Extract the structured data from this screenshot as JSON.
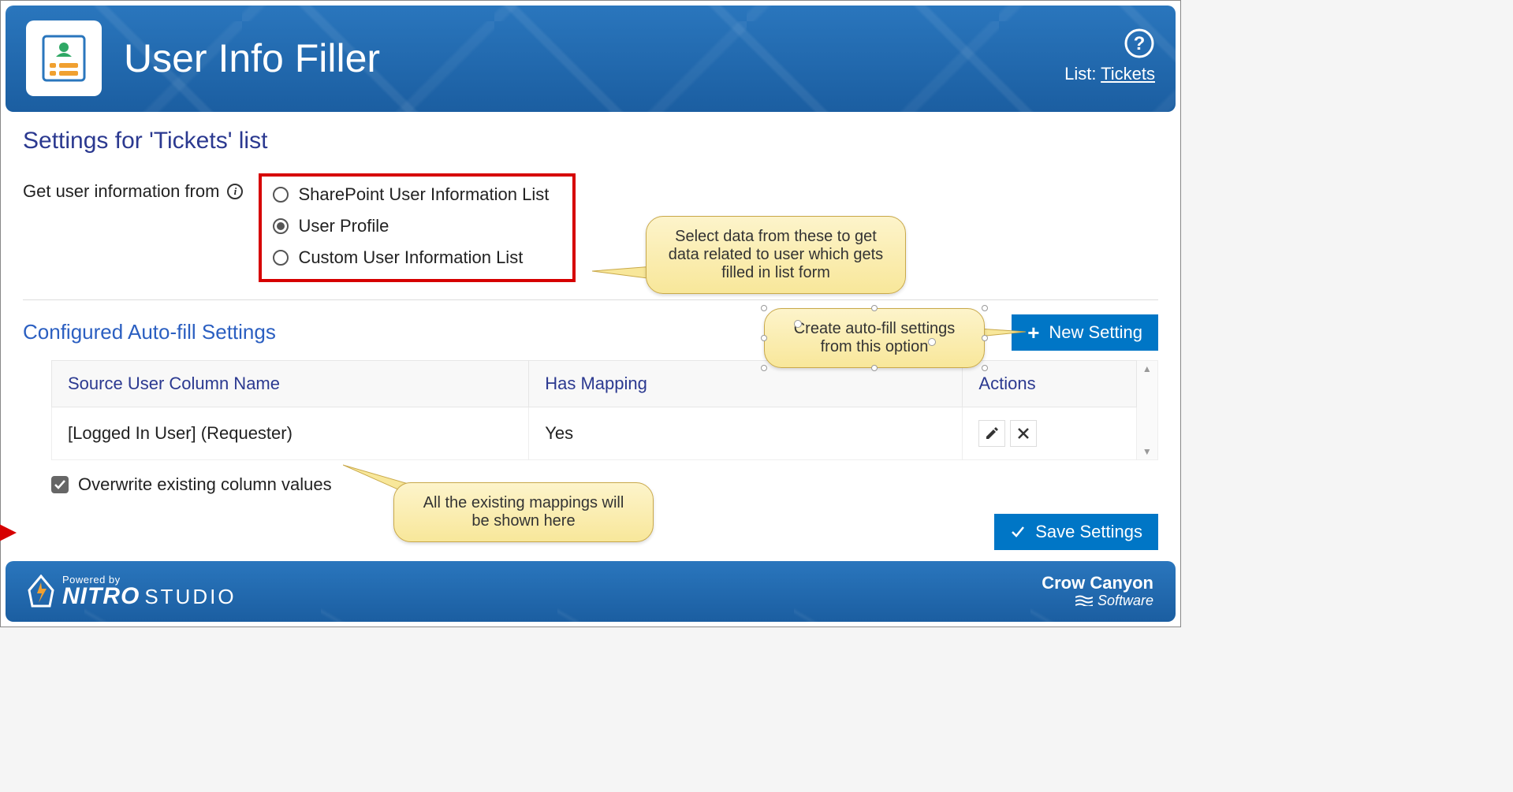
{
  "header": {
    "title": "User Info Filler",
    "list_prefix": "List: ",
    "list_name": "Tickets"
  },
  "settings": {
    "title": "Settings for 'Tickets' list",
    "source_label": "Get user information from",
    "options": [
      {
        "label": "SharePoint User Information List",
        "selected": false
      },
      {
        "label": "User Profile",
        "selected": true
      },
      {
        "label": "Custom User Information List",
        "selected": false
      }
    ]
  },
  "callouts": {
    "source": "Select data from these to get data related to user which gets filled in list form",
    "newsetting": "Create auto-fill settings from this option",
    "mappings": "All the existing mappings will be shown here"
  },
  "autofill": {
    "title": "Configured Auto-fill Settings",
    "new_button": "New Setting",
    "columns": {
      "source": "Source User Column Name",
      "mapping": "Has Mapping",
      "actions": "Actions"
    },
    "rows": [
      {
        "source": "[Logged In User] (Requester)",
        "mapping": "Yes"
      }
    ],
    "overwrite_label": "Overwrite existing column values",
    "overwrite_checked": true,
    "save_button": "Save Settings"
  },
  "footer": {
    "powered_by": "Powered by",
    "brand1": "NITRO",
    "brand2": "STUDIO",
    "company1": "Crow Canyon",
    "company2": "Software"
  }
}
